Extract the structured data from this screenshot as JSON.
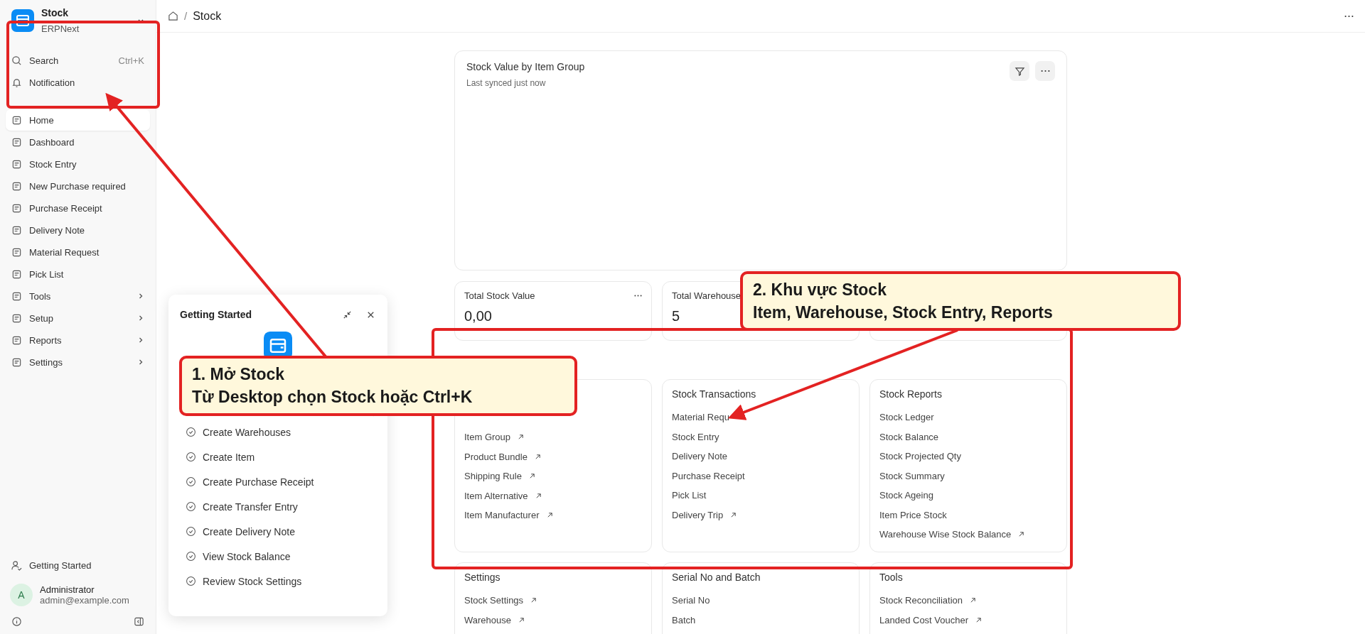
{
  "sidebar": {
    "app": {
      "name": "Stock",
      "subtitle": "ERPNext"
    },
    "search": {
      "label": "Search",
      "shortcut": "Ctrl+K"
    },
    "notification": {
      "label": "Notification"
    },
    "items": [
      {
        "label": "Home",
        "selected": true,
        "has_submenu": false
      },
      {
        "label": "Dashboard",
        "selected": false,
        "has_submenu": false
      },
      {
        "label": "Stock Entry",
        "selected": false,
        "has_submenu": false
      },
      {
        "label": "New Purchase required",
        "selected": false,
        "has_submenu": false
      },
      {
        "label": "Purchase Receipt",
        "selected": false,
        "has_submenu": false
      },
      {
        "label": "Delivery Note",
        "selected": false,
        "has_submenu": false
      },
      {
        "label": "Material Request",
        "selected": false,
        "has_submenu": false
      },
      {
        "label": "Pick List",
        "selected": false,
        "has_submenu": false
      },
      {
        "label": "Tools",
        "selected": false,
        "has_submenu": true
      },
      {
        "label": "Setup",
        "selected": false,
        "has_submenu": true
      },
      {
        "label": "Reports",
        "selected": false,
        "has_submenu": true
      },
      {
        "label": "Settings",
        "selected": false,
        "has_submenu": true
      }
    ],
    "getting_started": "Getting Started",
    "user": {
      "initial": "A",
      "name": "Administrator",
      "email": "admin@example.com"
    }
  },
  "breadcrumb": {
    "separator": "/",
    "items": [
      "Stock"
    ]
  },
  "chart_card": {
    "title": "Stock Value by Item Group",
    "subtitle": "Last synced just now"
  },
  "stat_cards": [
    {
      "label": "Total Stock Value",
      "value": "0,00",
      "has_menu": true
    },
    {
      "label": "Total Warehouse",
      "value": "5"
    }
  ],
  "link_cards": [
    {
      "links": [
        {
          "label": "Item Group",
          "external": true
        },
        {
          "label": "Product Bundle",
          "external": true
        },
        {
          "label": "Shipping Rule",
          "external": true
        },
        {
          "label": "Item Alternative",
          "external": true
        },
        {
          "label": "Item Manufacturer",
          "external": true
        }
      ]
    },
    {
      "title": "Stock Transactions",
      "links": [
        {
          "label": "Material Requ"
        },
        {
          "label": "Stock Entry",
          "external": false
        },
        {
          "label": "Delivery Note",
          "external": false
        },
        {
          "label": "Purchase Receipt",
          "external": false
        },
        {
          "label": "Pick List",
          "external": false
        },
        {
          "label": "Delivery Trip",
          "external": true
        }
      ]
    },
    {
      "title": "Stock Reports",
      "links": [
        {
          "label": "Stock Ledger",
          "external": false
        },
        {
          "label": "Stock Balance",
          "external": false
        },
        {
          "label": "Stock Projected Qty",
          "external": false
        },
        {
          "label": "Stock Summary",
          "external": false
        },
        {
          "label": "Stock Ageing",
          "external": false
        },
        {
          "label": "Item Price Stock",
          "external": false
        },
        {
          "label": "Warehouse Wise Stock Balance",
          "external": true
        }
      ]
    },
    {
      "title": "Settings",
      "links": [
        {
          "label": "Stock Settings",
          "external": true
        },
        {
          "label": "Warehouse",
          "external": true
        }
      ]
    },
    {
      "title": "Serial No and Batch",
      "links": [
        {
          "label": "Serial No",
          "external": false
        },
        {
          "label": "Batch",
          "external": false
        }
      ]
    },
    {
      "title": "Tools",
      "links": [
        {
          "label": "Stock Reconciliation",
          "external": true
        },
        {
          "label": "Landed Cost Voucher",
          "external": true
        }
      ]
    }
  ],
  "getting_started_panel": {
    "title": "Getting Started",
    "steps": [
      "Create Warehouses",
      "Create Item",
      "Create Purchase Receipt",
      "Create Transfer Entry",
      "Create Delivery Note",
      "View Stock Balance",
      "Review Stock Settings"
    ]
  },
  "callouts": [
    {
      "lines": [
        "1. Mở Stock",
        "Từ Desktop chọn Stock hoặc Ctrl+K"
      ]
    },
    {
      "lines": [
        "2. Khu vực Stock",
        "Item, Warehouse, Stock Entry, Reports"
      ]
    }
  ]
}
